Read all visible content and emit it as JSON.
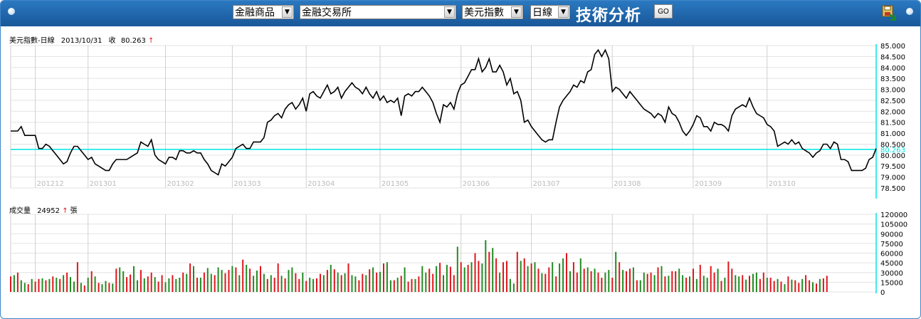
{
  "toolbar": {
    "product_select": "金融商品",
    "exchange_select": "金融交易所",
    "index_select": "美元指數",
    "period_select": "日線",
    "title": "技術分析",
    "go_label": "GO",
    "accent": "#1f64a9"
  },
  "price_panel": {
    "name": "美元指數-日線",
    "date": "2013/10/31",
    "close_label": "收",
    "close_value": "80.263",
    "up_arrow": "↑"
  },
  "volume_panel": {
    "name": "成交量",
    "value": "24952",
    "up_arrow": "↑",
    "unit": "張"
  },
  "chart_data": [
    {
      "type": "line",
      "name": "美元指數-日線",
      "ylim": [
        78.5,
        85.0
      ],
      "yticks": [
        "85.000",
        "84.500",
        "84.000",
        "83.500",
        "83.000",
        "82.500",
        "82.000",
        "81.500",
        "81.000",
        "80.500",
        "80.000",
        "79.500",
        "79.000",
        "78.500"
      ],
      "months": [
        {
          "label": "201212",
          "index": 7
        },
        {
          "label": "201301",
          "index": 22
        },
        {
          "label": "201302",
          "index": 44
        },
        {
          "label": "201303",
          "index": 63
        },
        {
          "label": "201304",
          "index": 84
        },
        {
          "label": "201305",
          "index": 105
        },
        {
          "label": "201306",
          "index": 128
        },
        {
          "label": "201307",
          "index": 148
        },
        {
          "label": "201308",
          "index": 171
        },
        {
          "label": "201309",
          "index": 194
        },
        {
          "label": "201310",
          "index": 215
        }
      ],
      "current_value": 80.263,
      "line_color": "#000000",
      "ref_line_color": "#00e5e5",
      "values": [
        81.1,
        81.1,
        81.1,
        81.3,
        80.9,
        80.9,
        80.9,
        80.9,
        80.3,
        80.3,
        80.5,
        80.4,
        80.2,
        80.0,
        79.8,
        79.6,
        79.7,
        80.1,
        80.4,
        80.4,
        80.2,
        80.0,
        79.8,
        79.9,
        79.6,
        79.5,
        79.4,
        79.3,
        79.3,
        79.6,
        79.8,
        79.8,
        79.8,
        79.8,
        79.9,
        80.0,
        80.1,
        80.6,
        80.5,
        80.4,
        80.7,
        80.0,
        79.8,
        79.7,
        79.6,
        79.9,
        79.9,
        79.8,
        80.2,
        80.2,
        80.1,
        80.1,
        80.2,
        80.1,
        80.1,
        79.8,
        79.6,
        79.3,
        79.2,
        79.1,
        79.6,
        79.5,
        79.7,
        79.9,
        80.3,
        80.4,
        80.5,
        80.3,
        80.3,
        80.6,
        80.6,
        80.6,
        80.8,
        81.5,
        81.6,
        81.8,
        81.9,
        81.7,
        82.1,
        82.3,
        82.4,
        82.1,
        82.3,
        82.6,
        82.0,
        82.8,
        82.9,
        82.7,
        82.6,
        82.9,
        83.2,
        82.8,
        82.9,
        83.1,
        82.6,
        82.9,
        83.1,
        83.3,
        83.1,
        83.0,
        82.8,
        83.1,
        82.8,
        82.6,
        82.9,
        82.5,
        82.7,
        82.4,
        82.5,
        82.4,
        82.6,
        81.8,
        82.7,
        82.8,
        82.7,
        82.9,
        82.9,
        83.1,
        82.9,
        82.7,
        82.4,
        81.9,
        81.5,
        82.3,
        82.2,
        82.4,
        82.1,
        82.8,
        83.2,
        83.3,
        83.6,
        83.9,
        83.9,
        84.4,
        83.8,
        84.0,
        84.4,
        83.8,
        83.8,
        84.1,
        83.8,
        83.2,
        83.5,
        82.8,
        82.9,
        82.5,
        81.5,
        81.6,
        81.3,
        81.1,
        80.9,
        80.7,
        80.6,
        80.7,
        80.7,
        81.5,
        82.2,
        82.5,
        82.7,
        82.9,
        83.2,
        83.1,
        83.4,
        83.3,
        83.8,
        83.9,
        84.6,
        84.8,
        84.5,
        84.8,
        84.4,
        82.9,
        83.1,
        83.0,
        82.8,
        82.6,
        82.9,
        82.7,
        82.5,
        82.3,
        82.1,
        82.0,
        81.9,
        81.7,
        81.9,
        81.8,
        81.5,
        82.2,
        81.9,
        81.8,
        81.5,
        81.1,
        80.9,
        81.1,
        81.4,
        81.8,
        81.7,
        81.3,
        81.3,
        81.1,
        81.5,
        81.4,
        81.4,
        81.3,
        81.1,
        81.8,
        82.1,
        82.2,
        82.3,
        82.2,
        82.6,
        82.2,
        81.9,
        81.8,
        81.7,
        81.4,
        81.3,
        81.1,
        80.4,
        80.5,
        80.6,
        80.5,
        80.7,
        80.5,
        80.6,
        80.3,
        80.2,
        80.1,
        79.9,
        80.1,
        80.2,
        80.5,
        80.5,
        80.3,
        80.6,
        80.5,
        79.8,
        79.8,
        79.7,
        79.3,
        79.3,
        79.3,
        79.3,
        79.4,
        79.8,
        79.9,
        80.3
      ]
    },
    {
      "type": "bar",
      "name": "成交量",
      "ylim": [
        0,
        120000
      ],
      "yticks": [
        "120000",
        "105000",
        "90000",
        "75000",
        "60000",
        "45000",
        "30000",
        "15000",
        "0"
      ],
      "up_color": "#228b22",
      "down_color": "#e0161c",
      "values": [
        24000,
        26000,
        30000,
        18000,
        14000,
        12000,
        20000,
        16000,
        20000,
        21000,
        18000,
        20000,
        24000,
        22000,
        20000,
        26000,
        30000,
        23000,
        16000,
        46000,
        14000,
        10000,
        22000,
        32000,
        24000,
        14000,
        12000,
        17000,
        14000,
        13000,
        36000,
        38000,
        32000,
        23000,
        27000,
        40000,
        18000,
        34000,
        21000,
        24000,
        30000,
        23000,
        16000,
        26000,
        15000,
        21000,
        26000,
        20000,
        22000,
        30000,
        28000,
        44000,
        40000,
        22000,
        22000,
        30000,
        37000,
        28000,
        26000,
        38000,
        34000,
        29000,
        34000,
        40000,
        38000,
        26000,
        50000,
        42000,
        36000,
        25000,
        33000,
        40000,
        28000,
        20000,
        26000,
        22000,
        44000,
        25000,
        21000,
        34000,
        38000,
        29000,
        20000,
        30000,
        17000,
        22000,
        20000,
        21000,
        28000,
        26000,
        34000,
        42000,
        35000,
        30000,
        26000,
        29000,
        44000,
        26000,
        24000,
        18000,
        28000,
        26000,
        35000,
        38000,
        30000,
        31000,
        44000,
        46000,
        18000,
        18000,
        22000,
        25000,
        38000,
        16000,
        20000,
        20000,
        24000,
        40000,
        30000,
        36000,
        28000,
        40000,
        45000,
        26000,
        42000,
        39000,
        26000,
        70000,
        46000,
        38000,
        42000,
        46000,
        60000,
        48000,
        44000,
        80000,
        62000,
        68000,
        52000,
        30000,
        46000,
        48000,
        20000,
        13000,
        62000,
        48000,
        52000,
        40000,
        44000,
        46000,
        36000,
        29000,
        28000,
        38000,
        46000,
        24000,
        44000,
        52000,
        60000,
        32000,
        46000,
        30000,
        52000,
        36000,
        38000,
        32000,
        36000,
        30000,
        22000,
        30000,
        34000,
        22000,
        62000,
        46000,
        34000,
        32000,
        36000,
        38000,
        18000,
        18000,
        30000,
        28000,
        30000,
        26000,
        38000,
        40000,
        24000,
        25000,
        32000,
        32000,
        36000,
        26000,
        22000,
        24000,
        36000,
        20000,
        42000,
        25000,
        22000,
        40000,
        30000,
        36000,
        17000,
        22000,
        47000,
        36000,
        26000,
        24000,
        26000,
        19000,
        25000,
        28000,
        30000,
        20000,
        30000,
        22000,
        22000,
        17000,
        20000,
        16000,
        12000,
        24000,
        19000,
        18000,
        14000,
        20000,
        26000,
        18000,
        15000,
        13000,
        20000,
        21000,
        25000
      ],
      "up_flags": [
        0,
        1,
        0,
        1,
        1,
        0,
        1,
        0,
        0,
        1,
        0,
        1,
        0,
        1,
        0,
        1,
        0,
        1,
        1,
        0,
        1,
        0,
        1,
        0,
        1,
        0,
        1,
        1,
        0,
        1,
        0,
        1,
        1,
        0,
        0,
        1,
        1,
        0,
        1,
        0,
        0,
        1,
        0,
        0,
        1,
        1,
        0,
        1,
        1,
        0,
        1,
        0,
        1,
        0,
        1,
        0,
        1,
        1,
        0,
        1,
        1,
        0,
        0,
        1,
        0,
        1,
        0,
        1,
        0,
        1,
        1,
        0,
        1,
        0,
        1,
        0,
        0,
        1,
        0,
        1,
        1,
        0,
        0,
        1,
        0,
        1,
        1,
        0,
        0,
        1,
        0,
        1,
        0,
        1,
        0,
        1,
        0,
        1,
        1,
        0,
        0,
        1,
        0,
        1,
        0,
        1,
        0,
        1,
        1,
        0,
        1,
        0,
        1,
        0,
        0,
        1,
        0,
        1,
        1,
        0,
        0,
        1,
        0,
        1,
        1,
        0,
        0,
        1,
        0,
        1,
        0,
        1,
        0,
        0,
        1,
        1,
        0,
        1,
        0,
        1,
        0,
        0,
        1,
        1,
        0,
        1,
        0,
        1,
        0,
        1,
        0,
        1,
        0,
        0,
        1,
        0,
        1,
        1,
        0,
        1,
        0,
        0,
        1,
        0,
        1,
        0,
        1,
        0,
        0,
        1,
        1,
        0,
        1,
        0,
        1,
        0,
        0,
        1,
        0,
        1,
        1,
        0,
        0,
        1,
        0,
        1,
        0,
        1,
        0,
        0,
        1,
        1,
        0,
        1,
        0,
        1,
        0,
        1,
        1,
        0,
        0,
        1,
        0,
        1,
        0,
        0,
        1,
        1,
        0,
        1,
        0,
        1,
        1,
        0,
        0,
        1,
        0,
        0,
        1,
        0,
        1,
        0,
        1,
        0,
        0,
        1,
        0,
        0,
        1,
        0,
        1,
        0,
        0,
        1,
        0,
        0
      ]
    }
  ]
}
